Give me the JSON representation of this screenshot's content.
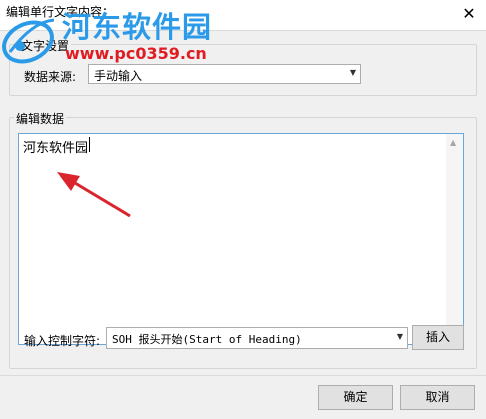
{
  "window": {
    "title": "编辑单行文字内容：",
    "close_glyph": "✕"
  },
  "watermark": {
    "site_name": "河东软件园",
    "url": "www.pc0359.cn"
  },
  "text_settings": {
    "group_label": "文字设置",
    "source_label": "数据来源:",
    "source_value": "手动输入"
  },
  "edit_data": {
    "group_label": "编辑数据",
    "content": "河东软件园",
    "control_char_label": "输入控制字符:",
    "control_char_value": "SOH   报头开始(Start of Heading)",
    "insert_button": "插入"
  },
  "footer": {
    "ok_button": "确定",
    "cancel_button": "取消"
  },
  "colors": {
    "arrow": "#d9252b",
    "watermark_blue": "#2b9ae8",
    "watermark_red": "#e11b22"
  }
}
